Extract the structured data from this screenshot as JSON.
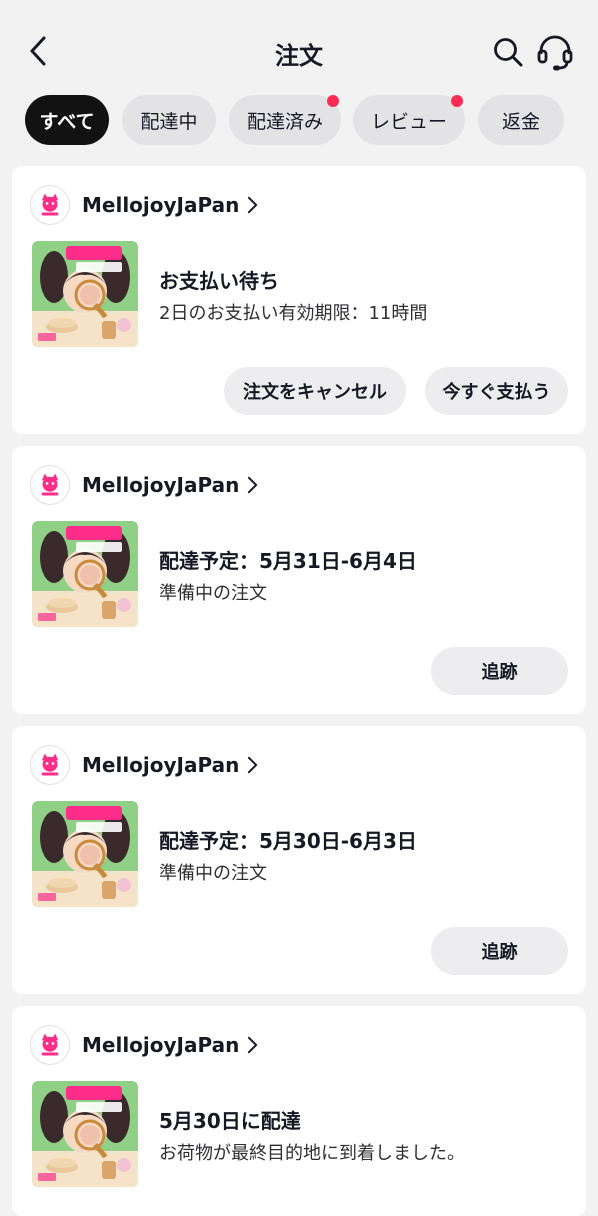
{
  "header": {
    "title": "注文",
    "back_icon": "chevron-left-icon",
    "search_icon": "search-icon",
    "support_icon": "headset-icon"
  },
  "tabs": [
    {
      "label": "すべて",
      "active": true,
      "badge": false
    },
    {
      "label": "配達中",
      "active": false,
      "badge": false
    },
    {
      "label": "配達済み",
      "active": false,
      "badge": true
    },
    {
      "label": "レビュー",
      "active": false,
      "badge": true
    },
    {
      "label": "返金",
      "active": false,
      "badge": false
    }
  ],
  "orders": [
    {
      "shop_name": "MellojoyJaPan",
      "status_title": "お支払い待ち",
      "status_sub": "2日のお支払い有効期限：11時間",
      "actions": [
        "注文をキャンセル",
        "今すぐ支払う"
      ]
    },
    {
      "shop_name": "MellojoyJaPan",
      "status_title": "配達予定：5月31日-6月4日",
      "status_sub": "準備中の注文",
      "actions": [
        "追跡"
      ]
    },
    {
      "shop_name": "MellojoyJaPan",
      "status_title": "配達予定：5月30日-6月3日",
      "status_sub": "準備中の注文",
      "actions": [
        "追跡"
      ]
    },
    {
      "shop_name": "MellojoyJaPan",
      "status_title": "5月30日に配達",
      "status_sub": "お荷物が最終目的地に到着しました。",
      "actions": []
    }
  ],
  "colors": {
    "accent": "#fe2c55",
    "active_tab": "#121212",
    "background": "#f2f2f2"
  }
}
